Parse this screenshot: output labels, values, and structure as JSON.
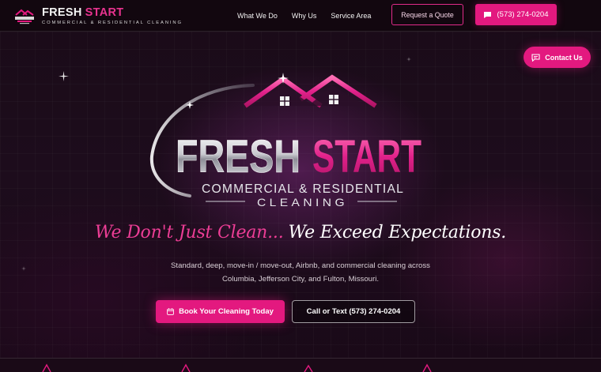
{
  "brand": {
    "name_part1": "FRESH",
    "name_part2": "START",
    "subtitle": "COMMERCIAL & RESIDENTIAL CLEANING"
  },
  "nav": {
    "items": [
      {
        "label": "What We Do"
      },
      {
        "label": "Why Us"
      },
      {
        "label": "Service Area"
      }
    ],
    "quote_button": "Request a Quote",
    "phone_button": "(573) 274-0204"
  },
  "contact_float": {
    "label": "Contact Us"
  },
  "hero": {
    "logo_word1": "FRESH",
    "logo_word2": "START",
    "logo_line1": "COMMERCIAL & RESIDENTIAL",
    "logo_line2": "CLEANING",
    "tagline_part1": "We Don't Just Clean...",
    "tagline_part2": "We Exceed Expectations.",
    "description_line1": "Standard, deep, move-in / move-out, Airbnb, and commercial cleaning across",
    "description_line2": "Columbia, Jefferson City, and Fulton, Missouri.",
    "primary_cta": "Book Your Cleaning Today",
    "secondary_cta": "Call or Text (573) 274-0204"
  },
  "colors": {
    "accent": "#e3197f",
    "accent_text": "#ec3d95",
    "background": "#160914",
    "header_bg": "#12070f"
  },
  "icons": {
    "phone_button": "chat-icon",
    "contact_float": "message-icon",
    "book_button": "calendar-icon"
  }
}
